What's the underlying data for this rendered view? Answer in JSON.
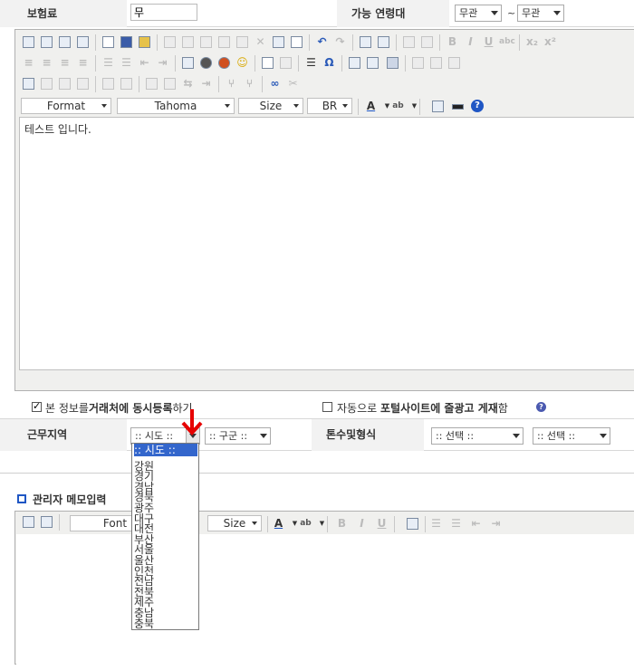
{
  "header": {
    "insurance_label": "보험료",
    "insurance_value": "무",
    "age_label": "가능 연령대",
    "age_from": "무관",
    "age_sep": "~",
    "age_to": "무관"
  },
  "editor": {
    "format_label": "Format",
    "font_label": "Tahoma",
    "size_label": "Size",
    "style_label": "BR",
    "content_text": "테스트 입니다."
  },
  "options": {
    "register_check": "본 정보를",
    "register_bold": "거래처에 동시등록",
    "register_tail": "하기",
    "portal_prefix": "자동으로",
    "portal_bold": "포털사이트에 줄광고 게재",
    "portal_tail": "함"
  },
  "work_area": {
    "label": "근무지역",
    "sido_value": ":: 시도 ::",
    "gugun_value": ":: 구군 ::",
    "pay_label": "톤수및형식",
    "pay_select1": ":: 선택 ::",
    "pay_select2": ":: 선택 ::",
    "sido_options": [
      ":: 시도 ::",
      "강원",
      "경기",
      "경남",
      "경북",
      "광주",
      "대구",
      "대전",
      "부산",
      "서울",
      "울산",
      "인천",
      "전남",
      "전북",
      "제주",
      "충남",
      "충북"
    ]
  },
  "memo": {
    "title": "관리자 메모입력",
    "font_label": "Font",
    "size_label": "Size"
  },
  "colors": {
    "accent": "#1f56c4",
    "selected": "#3366cc",
    "arrow": "#e60000"
  }
}
